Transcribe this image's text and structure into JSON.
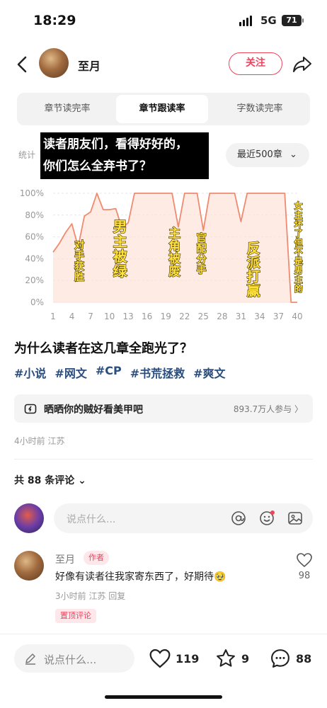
{
  "status": {
    "time": "18:29",
    "network": "5G",
    "battery": "71"
  },
  "header": {
    "author": "至月",
    "follow_label": "关注"
  },
  "tabs": [
    {
      "label": "章节读完率",
      "active": false
    },
    {
      "label": "章节跟读率",
      "active": true
    },
    {
      "label": "字数读完率",
      "active": false
    }
  ],
  "stat_label": "统计",
  "overlay_text_1": "读者朋友们，看得好好的，",
  "overlay_text_2": "你们怎么全弃书了？",
  "range_label": "最近500章",
  "chart_data": {
    "type": "area",
    "x": [
      1,
      2,
      3,
      4,
      5,
      6,
      7,
      8,
      9,
      10,
      11,
      12,
      13,
      14,
      15,
      16,
      17,
      18,
      19,
      20,
      21,
      22,
      23,
      24,
      25,
      26,
      27,
      28,
      29,
      30,
      31,
      32,
      33,
      34,
      35,
      36,
      37,
      38,
      39,
      40
    ],
    "values": [
      46,
      54,
      64,
      72,
      51,
      79,
      83,
      100,
      85,
      85,
      86,
      68,
      73,
      100,
      100,
      100,
      100,
      100,
      100,
      100,
      69,
      100,
      100,
      100,
      66,
      100,
      100,
      100,
      100,
      100,
      74,
      100,
      100,
      100,
      100,
      100,
      100,
      100,
      0,
      0
    ],
    "x_ticks": [
      "1",
      "4",
      "7",
      "10",
      "13",
      "16",
      "19",
      "22",
      "25",
      "28",
      "31",
      "34",
      "37",
      "40"
    ],
    "y_ticks": [
      "0%",
      "20%",
      "40%",
      "60%",
      "80%",
      "100%"
    ],
    "ylim": [
      0,
      100
    ],
    "line_color": "#f08a70",
    "fill_color": "#fde3d8",
    "annotations": [
      "对手获胜",
      "男主被绿",
      "主角被废",
      "官配分手",
      "反派打赢",
      "女主坏了但不是男主的"
    ]
  },
  "question": "为什么读者在这几章全跑光了？",
  "tags": [
    "#小说",
    "#网文",
    "#CP",
    "#书荒拯救",
    "#爽文"
  ],
  "topic": {
    "text": "晒晒你的贼好看美甲吧",
    "count": "893.7万人参与 〉"
  },
  "meta": "4小时前 江苏",
  "comments_count": "共 88 条评论 ⌄",
  "input_placeholder": "说点什么...",
  "comment": {
    "name": "至月",
    "badge": "作者",
    "text": "好像有读者往我家寄东西了，好期待🥹",
    "meta": "3小时前 江苏 回复",
    "pinned": "置顶评论",
    "likes": "98"
  },
  "bottom": {
    "placeholder": "说点什么...",
    "likes": "119",
    "stars": "9",
    "comments": "88"
  }
}
